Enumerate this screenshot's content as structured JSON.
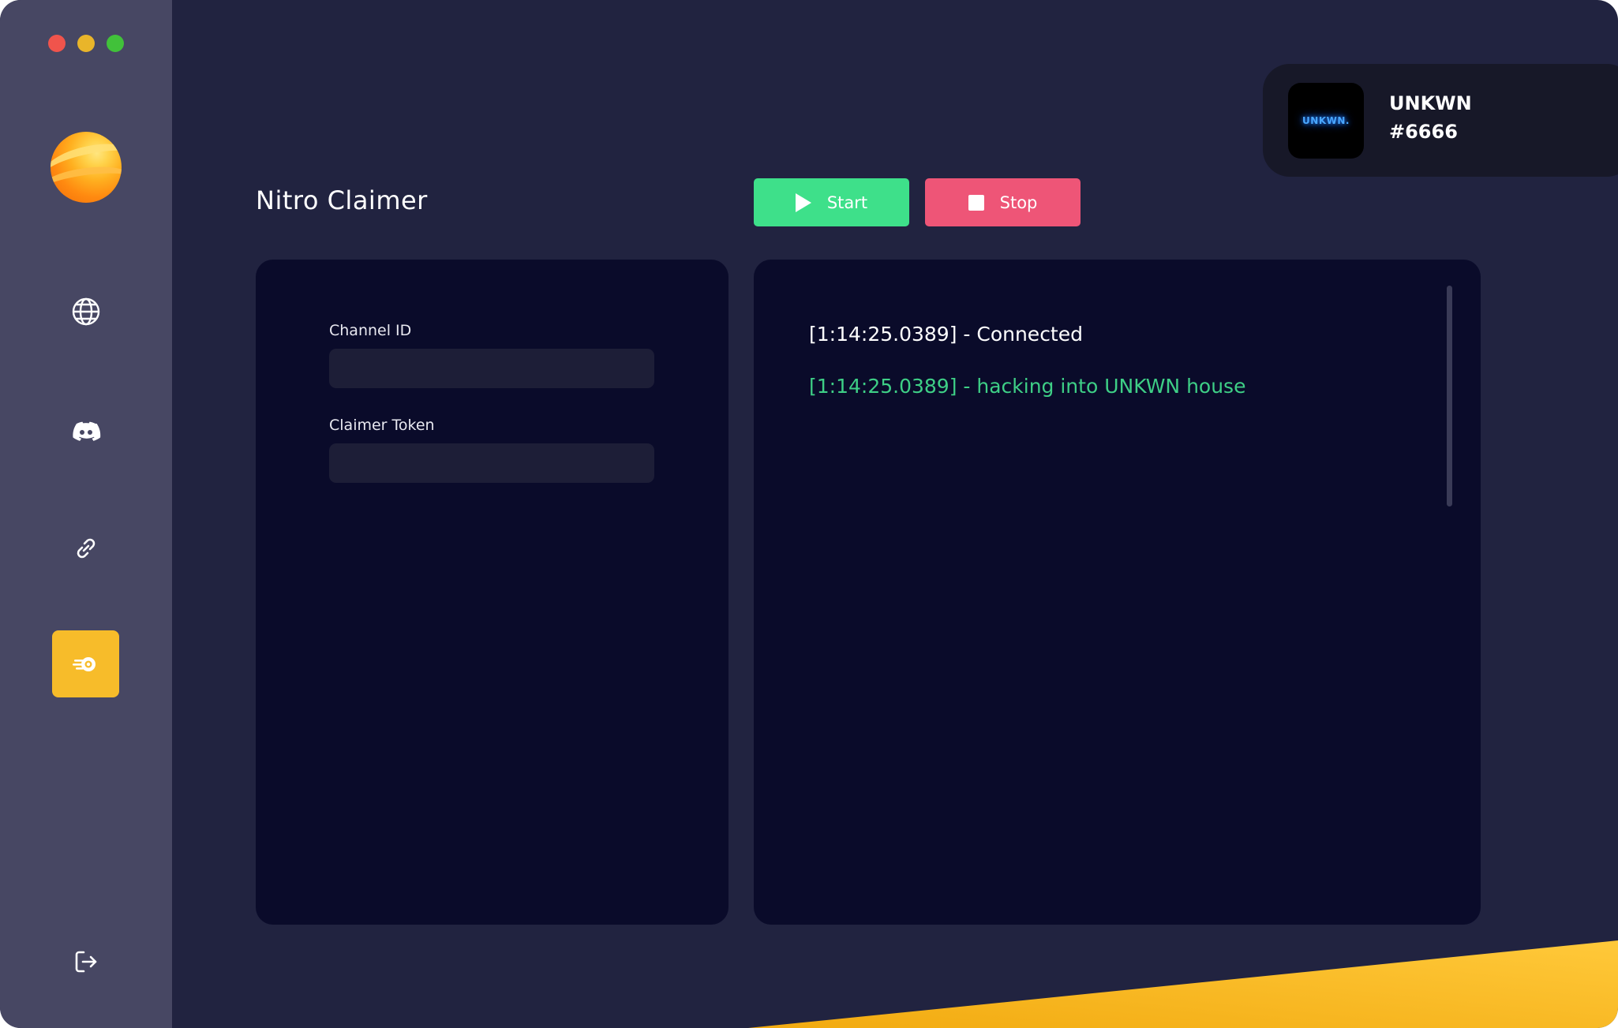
{
  "window": {
    "title": "Nitro Claimer",
    "controls": [
      "close",
      "minimize",
      "maximize"
    ]
  },
  "sidebar": {
    "items": [
      {
        "name": "browser",
        "icon": "globe-icon",
        "active": false
      },
      {
        "name": "discord",
        "icon": "discord-icon",
        "active": false
      },
      {
        "name": "links",
        "icon": "link-icon",
        "active": false
      },
      {
        "name": "nitro-claimer",
        "icon": "nitro-icon",
        "active": true
      }
    ],
    "logout_icon": "logout-icon"
  },
  "profile": {
    "avatar_text": "UNKWN.",
    "username": "UNKWN",
    "tag": "#6666"
  },
  "header": {
    "title": "Nitro Claimer",
    "start_label": "Start",
    "stop_label": "Stop"
  },
  "form": {
    "channel_id": {
      "label": "Channel ID",
      "value": "",
      "placeholder": ""
    },
    "claimer_token": {
      "label": "Claimer Token",
      "value": "",
      "placeholder": ""
    }
  },
  "console": {
    "lines": [
      {
        "text": "[1:14:25.0389] - Connected",
        "color": "#ffffff"
      },
      {
        "text": "[1:14:25.0389] - hacking into UNKWN house",
        "color": "#3ecf86"
      }
    ]
  },
  "colors": {
    "accent": "#f7bc2a",
    "start": "#3ee08a",
    "stop": "#ee5577",
    "background": "#212340",
    "sidebar": "#474763",
    "panel": "#0a0b2a"
  }
}
